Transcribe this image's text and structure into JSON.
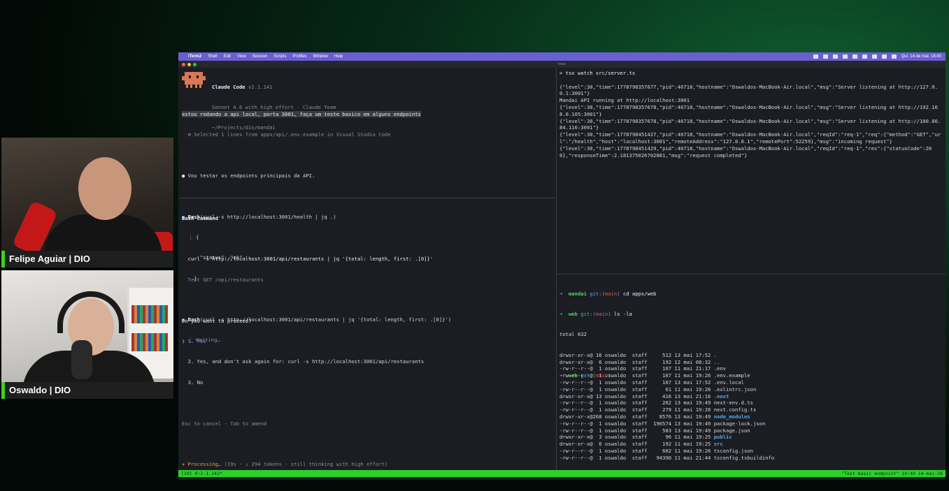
{
  "cameras": {
    "cam1_name": "Felipe Aguiar | DIO",
    "cam2_name": "Oswaldo | DIO"
  },
  "menubar": {
    "apple": "",
    "app": "iTerm2",
    "items": [
      "Shell",
      "Edit",
      "View",
      "Session",
      "Scripts",
      "Profiles",
      "Window",
      "Help"
    ],
    "clock": "Qui. 14 de mai.  18:40"
  },
  "window": {
    "title": "tmux"
  },
  "claude": {
    "title": "Claude Code",
    "version": "v2.1.141",
    "model": "Sonnet 4.6 with high effort · Claude Team",
    "path": "~/Projects/dio/mandai",
    "user_prompt": "estou rodando a api local, porta 3001, faça um teste basico em alguns endpoints",
    "selection_note": "⊞ Selected 1 lines from apps/api/.env.example in Visual Studio Code",
    "assistant_msg": "Vou testar os endpoints principais da API.",
    "bash1_label": "Bash",
    "bash1_cmd": "(curl -s http://localhost:3001/health | jq .)",
    "bash1_out": [
      "{",
      "  \"status\": \"ok\"",
      "}"
    ],
    "bash2_label": "Bash",
    "bash2_cmd": "(curl -s http://localhost:3001/api/restaurants | jq '{total: length, first: .[0]}')",
    "bash2_status": "Waiting…",
    "perm_title": "Bash command",
    "perm_cmd": "curl -s http://localhost:3001/api/restaurants | jq '{total: length, first: .[0]}'",
    "perm_desc": "Test GET /api/restaurants",
    "perm_question": "Do you want to proceed?",
    "opt1": "1. Yes",
    "opt2": "2. Yes, and don't ask again for: curl -s http://localhost:3001/api/restaurants",
    "opt3": "3. No",
    "hint": "Esc to cancel · Tab to amend",
    "processing": "Processing…",
    "processing_detail": "(19s · ↓ 294 tokens · still thinking with high effort)"
  },
  "server": {
    "cmd": "> tsx watch src/server.ts",
    "lines": [
      "{\"level\":30,\"time\":1778798357677,\"pid\":46718,\"hostname\":\"Oswaldos-MacBook-Air.local\",\"msg\":\"Server listening at http://127.0.0.1:3001\"}",
      "Mandai API running at http://localhost:3001",
      "{\"level\":30,\"time\":1778798357678,\"pid\":46718,\"hostname\":\"Oswaldos-MacBook-Air.local\",\"msg\":\"Server listening at http://192.168.0.105:3001\"}",
      "{\"level\":30,\"time\":1778798357678,\"pid\":46718,\"hostname\":\"Oswaldos-MacBook-Air.local\",\"msg\":\"Server listening at http://100.80.84.116:3001\"}",
      "{\"level\":30,\"time\":1778798451427,\"pid\":46718,\"hostname\":\"Oswaldos-MacBook-Air.local\",\"reqId\":\"req-1\",\"req\":{\"method\":\"GET\",\"url\":\"/health\",\"host\":\"localhost:3001\",\"remoteAddress\":\"127.0.0.1\",\"remotePort\":52259},\"msg\":\"incoming request\"}",
      "{\"level\":30,\"time\":1778798451429,\"pid\":46718,\"hostname\":\"Oswaldos-MacBook-Air.local\",\"reqId\":\"req-1\",\"res\":{\"statusCode\":200},\"responseTime\":2.181375026702881,\"msg\":\"request completed\"}"
    ]
  },
  "shell": {
    "prompt1_dir": "mandai",
    "prompt1_cmd": "cd apps/web",
    "prompt2_dir": "web",
    "prompt2_cmd": "ls -la",
    "git": "git:(",
    "branch": "main",
    "git_close": ")",
    "total": "total 632",
    "entries": [
      {
        "perm": "drwxr-xr-x@",
        "n": "16",
        "user": "oswaldo",
        "grp": "staff",
        "size": "512",
        "date": "13 mai 17:52",
        "name": ".",
        "kind": "dir"
      },
      {
        "perm": "drwxr-xr-x@",
        "n": " 6",
        "user": "oswaldo",
        "grp": "staff",
        "size": "192",
        "date": "12 mai 08:32",
        "name": "..",
        "kind": "dir"
      },
      {
        "perm": "-rw-r--r--@",
        "n": " 1",
        "user": "oswaldo",
        "grp": "staff",
        "size": "167",
        "date": "11 mai 21:17",
        "name": ".env",
        "kind": "file"
      },
      {
        "perm": "-rw-r--r--@",
        "n": " 1",
        "user": "oswaldo",
        "grp": "staff",
        "size": "167",
        "date": "11 mai 19:26",
        "name": ".env.example",
        "kind": "file"
      },
      {
        "perm": "-rw-r--r--@",
        "n": " 1",
        "user": "oswaldo",
        "grp": "staff",
        "size": "167",
        "date": "13 mai 17:52",
        "name": ".env.local",
        "kind": "file"
      },
      {
        "perm": "-rw-r--r--@",
        "n": " 1",
        "user": "oswaldo",
        "grp": "staff",
        "size": "61",
        "date": "11 mai 19:26",
        "name": ".eslintrc.json",
        "kind": "file"
      },
      {
        "perm": "drwxr-xr-x@",
        "n": "13",
        "user": "oswaldo",
        "grp": "staff",
        "size": "416",
        "date": "13 mai 21:16",
        "name": ".next",
        "kind": "dir"
      },
      {
        "perm": "-rw-r--r--@",
        "n": " 1",
        "user": "oswaldo",
        "grp": "staff",
        "size": "262",
        "date": "13 mai 19:49",
        "name": "next-env.d.ts",
        "kind": "file"
      },
      {
        "perm": "-rw-r--r--@",
        "n": " 1",
        "user": "oswaldo",
        "grp": "staff",
        "size": "279",
        "date": "11 mai 19:26",
        "name": "next.config.ts",
        "kind": "file"
      },
      {
        "perm": "drwxr-xr-x@",
        "n": "268",
        "user": "oswaldo",
        "grp": "staff",
        "size": "8576",
        "date": "13 mai 19:49",
        "name": "node_modules",
        "kind": "dir"
      },
      {
        "perm": "-rw-r--r--@",
        "n": " 1",
        "user": "oswaldo",
        "grp": "staff",
        "size": "190574",
        "date": "13 mai 19:49",
        "name": "package-lock.json",
        "kind": "file"
      },
      {
        "perm": "-rw-r--r--@",
        "n": " 1",
        "user": "oswaldo",
        "grp": "staff",
        "size": "583",
        "date": "13 mai 19:49",
        "name": "package.json",
        "kind": "file"
      },
      {
        "perm": "drwxr-xr-x@",
        "n": " 3",
        "user": "oswaldo",
        "grp": "staff",
        "size": "96",
        "date": "11 mai 19:25",
        "name": "public",
        "kind": "dir"
      },
      {
        "perm": "drwxr-xr-x@",
        "n": " 6",
        "user": "oswaldo",
        "grp": "staff",
        "size": "192",
        "date": "11 mai 19:25",
        "name": "src",
        "kind": "dir"
      },
      {
        "perm": "-rw-r--r--@",
        "n": " 1",
        "user": "oswaldo",
        "grp": "staff",
        "size": "602",
        "date": "11 mai 19:26",
        "name": "tsconfig.json",
        "kind": "file"
      },
      {
        "perm": "-rw-r--r--@",
        "n": " 1",
        "user": "oswaldo",
        "grp": "staff",
        "size": "94390",
        "date": "11 mai 21:44",
        "name": "tsconfig.tsbuildinfo",
        "kind": "file"
      }
    ],
    "prompt3_dir": "web"
  },
  "tmux": {
    "left": "[10] 0:2.1.141*",
    "right": "\"Test basic endpoint\" 19:40 14-mai-26"
  }
}
